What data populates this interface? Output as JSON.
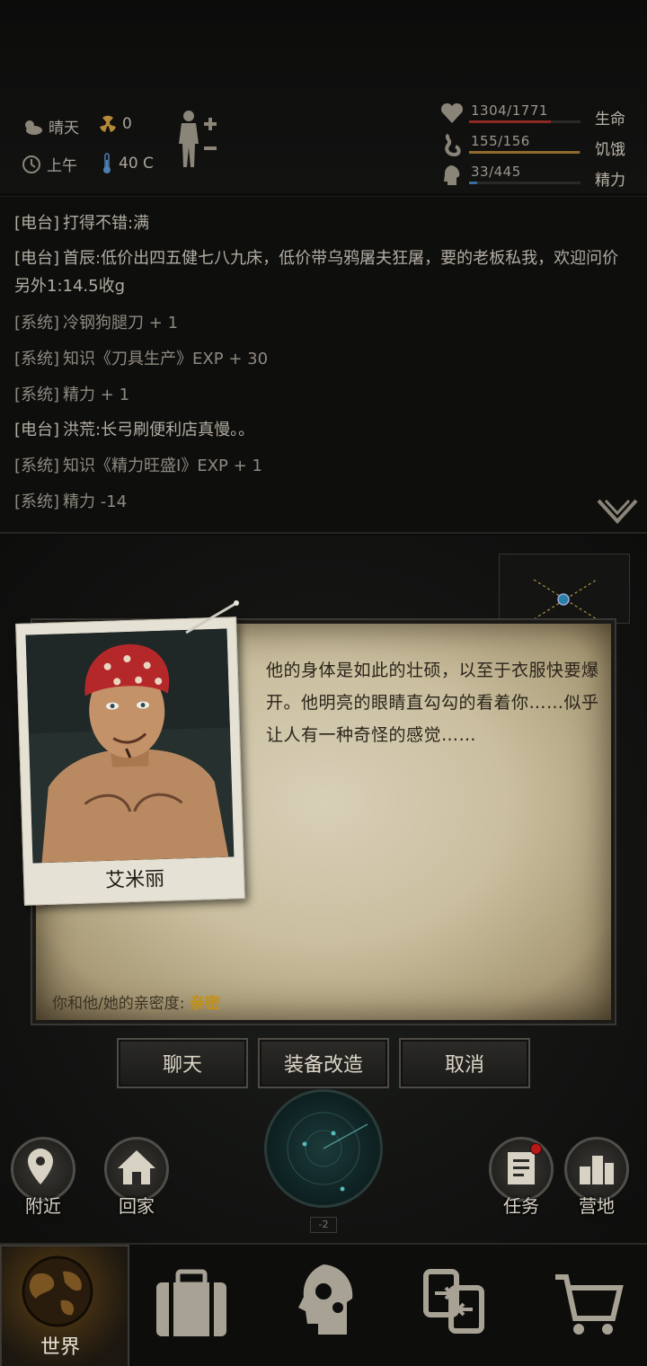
{
  "status": {
    "weather": "晴天",
    "radiation": "0",
    "time_of_day": "上午",
    "temperature": "40 C",
    "health": {
      "value": "1304/1771",
      "label": "生命",
      "ratio": 0.736,
      "color": "#8c2a22"
    },
    "hunger": {
      "value": "155/156",
      "label": "饥饿",
      "ratio": 0.99,
      "color": "#8f6a2e"
    },
    "energy": {
      "value": "33/445",
      "label": "精力",
      "ratio": 0.074,
      "color": "#3a6ea0"
    }
  },
  "log": [
    {
      "tag": "[电台]",
      "text": "打得不错:满",
      "kind": "radio"
    },
    {
      "tag": "[电台]",
      "text": "首辰:低价出四五健七八九床，低价带乌鸦屠夫狂屠，要的老板私我，欢迎问价另外1:14.5收g",
      "kind": "radio"
    },
    {
      "tag": "[系统]",
      "text": "冷钢狗腿刀 + 1",
      "kind": "system"
    },
    {
      "tag": "[系统]",
      "text": "知识《刀具生产》EXP + 30",
      "kind": "system"
    },
    {
      "tag": "[系统]",
      "text": "精力 + 1",
      "kind": "system"
    },
    {
      "tag": "[电台]",
      "text": "洪荒:长弓刷便利店真慢。。",
      "kind": "radio"
    },
    {
      "tag": "[系统]",
      "text": "知识《精力旺盛Ⅰ》EXP + 1",
      "kind": "system"
    },
    {
      "tag": "[系统]",
      "text": "精力 -14",
      "kind": "system"
    }
  ],
  "dialog": {
    "npc_name": "艾米丽",
    "description": "他的身体是如此的壮硕，以至于衣服快要爆开。他明亮的眼睛直勾勾的看着你……似乎让人有一种奇怪的感觉……",
    "affinity_label": "你和他/她的亲密度:",
    "affinity_value": "亲密"
  },
  "actions": {
    "chat": "聊天",
    "modify": "装备改造",
    "cancel": "取消"
  },
  "radar_level": "-2",
  "side_buttons": {
    "nearby": "附近",
    "home": "回家",
    "tasks": "任务",
    "camp": "营地"
  },
  "nav": {
    "world": "世界"
  },
  "colors": {
    "accent_gold": "#c39014",
    "paper": "#cabf9f"
  }
}
